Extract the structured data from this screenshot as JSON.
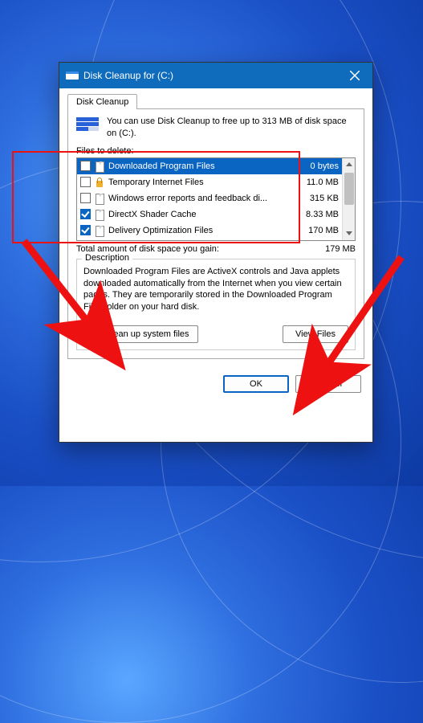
{
  "window": {
    "title": "Disk Cleanup for  (C:)",
    "tab_label": "Disk Cleanup",
    "intro_text": "You can use Disk Cleanup to free up to 313 MB of disk space on  (C:).",
    "files_to_delete_label": "Files to delete:",
    "items": [
      {
        "name": "Downloaded Program Files",
        "size": "0 bytes",
        "checked": false,
        "selected": true,
        "icon": "page"
      },
      {
        "name": "Temporary Internet Files",
        "size": "11.0 MB",
        "checked": false,
        "selected": false,
        "icon": "lock"
      },
      {
        "name": "Windows error reports and feedback di...",
        "size": "315 KB",
        "checked": false,
        "selected": false,
        "icon": "page"
      },
      {
        "name": "DirectX Shader Cache",
        "size": "8.33 MB",
        "checked": true,
        "selected": false,
        "icon": "page"
      },
      {
        "name": "Delivery Optimization Files",
        "size": "170 MB",
        "checked": true,
        "selected": false,
        "icon": "page"
      }
    ],
    "total_label": "Total amount of disk space you gain:",
    "total_value": "179 MB",
    "description_legend": "Description",
    "description_text": "Downloaded Program Files are ActiveX controls and Java applets downloaded automatically from the Internet when you view certain pages. They are temporarily stored in the Downloaded Program Files folder on your hard disk.",
    "cleanup_system_label": "Clean up system files",
    "view_files_label": "View Files",
    "ok_label": "OK",
    "cancel_label": "Cancel"
  }
}
